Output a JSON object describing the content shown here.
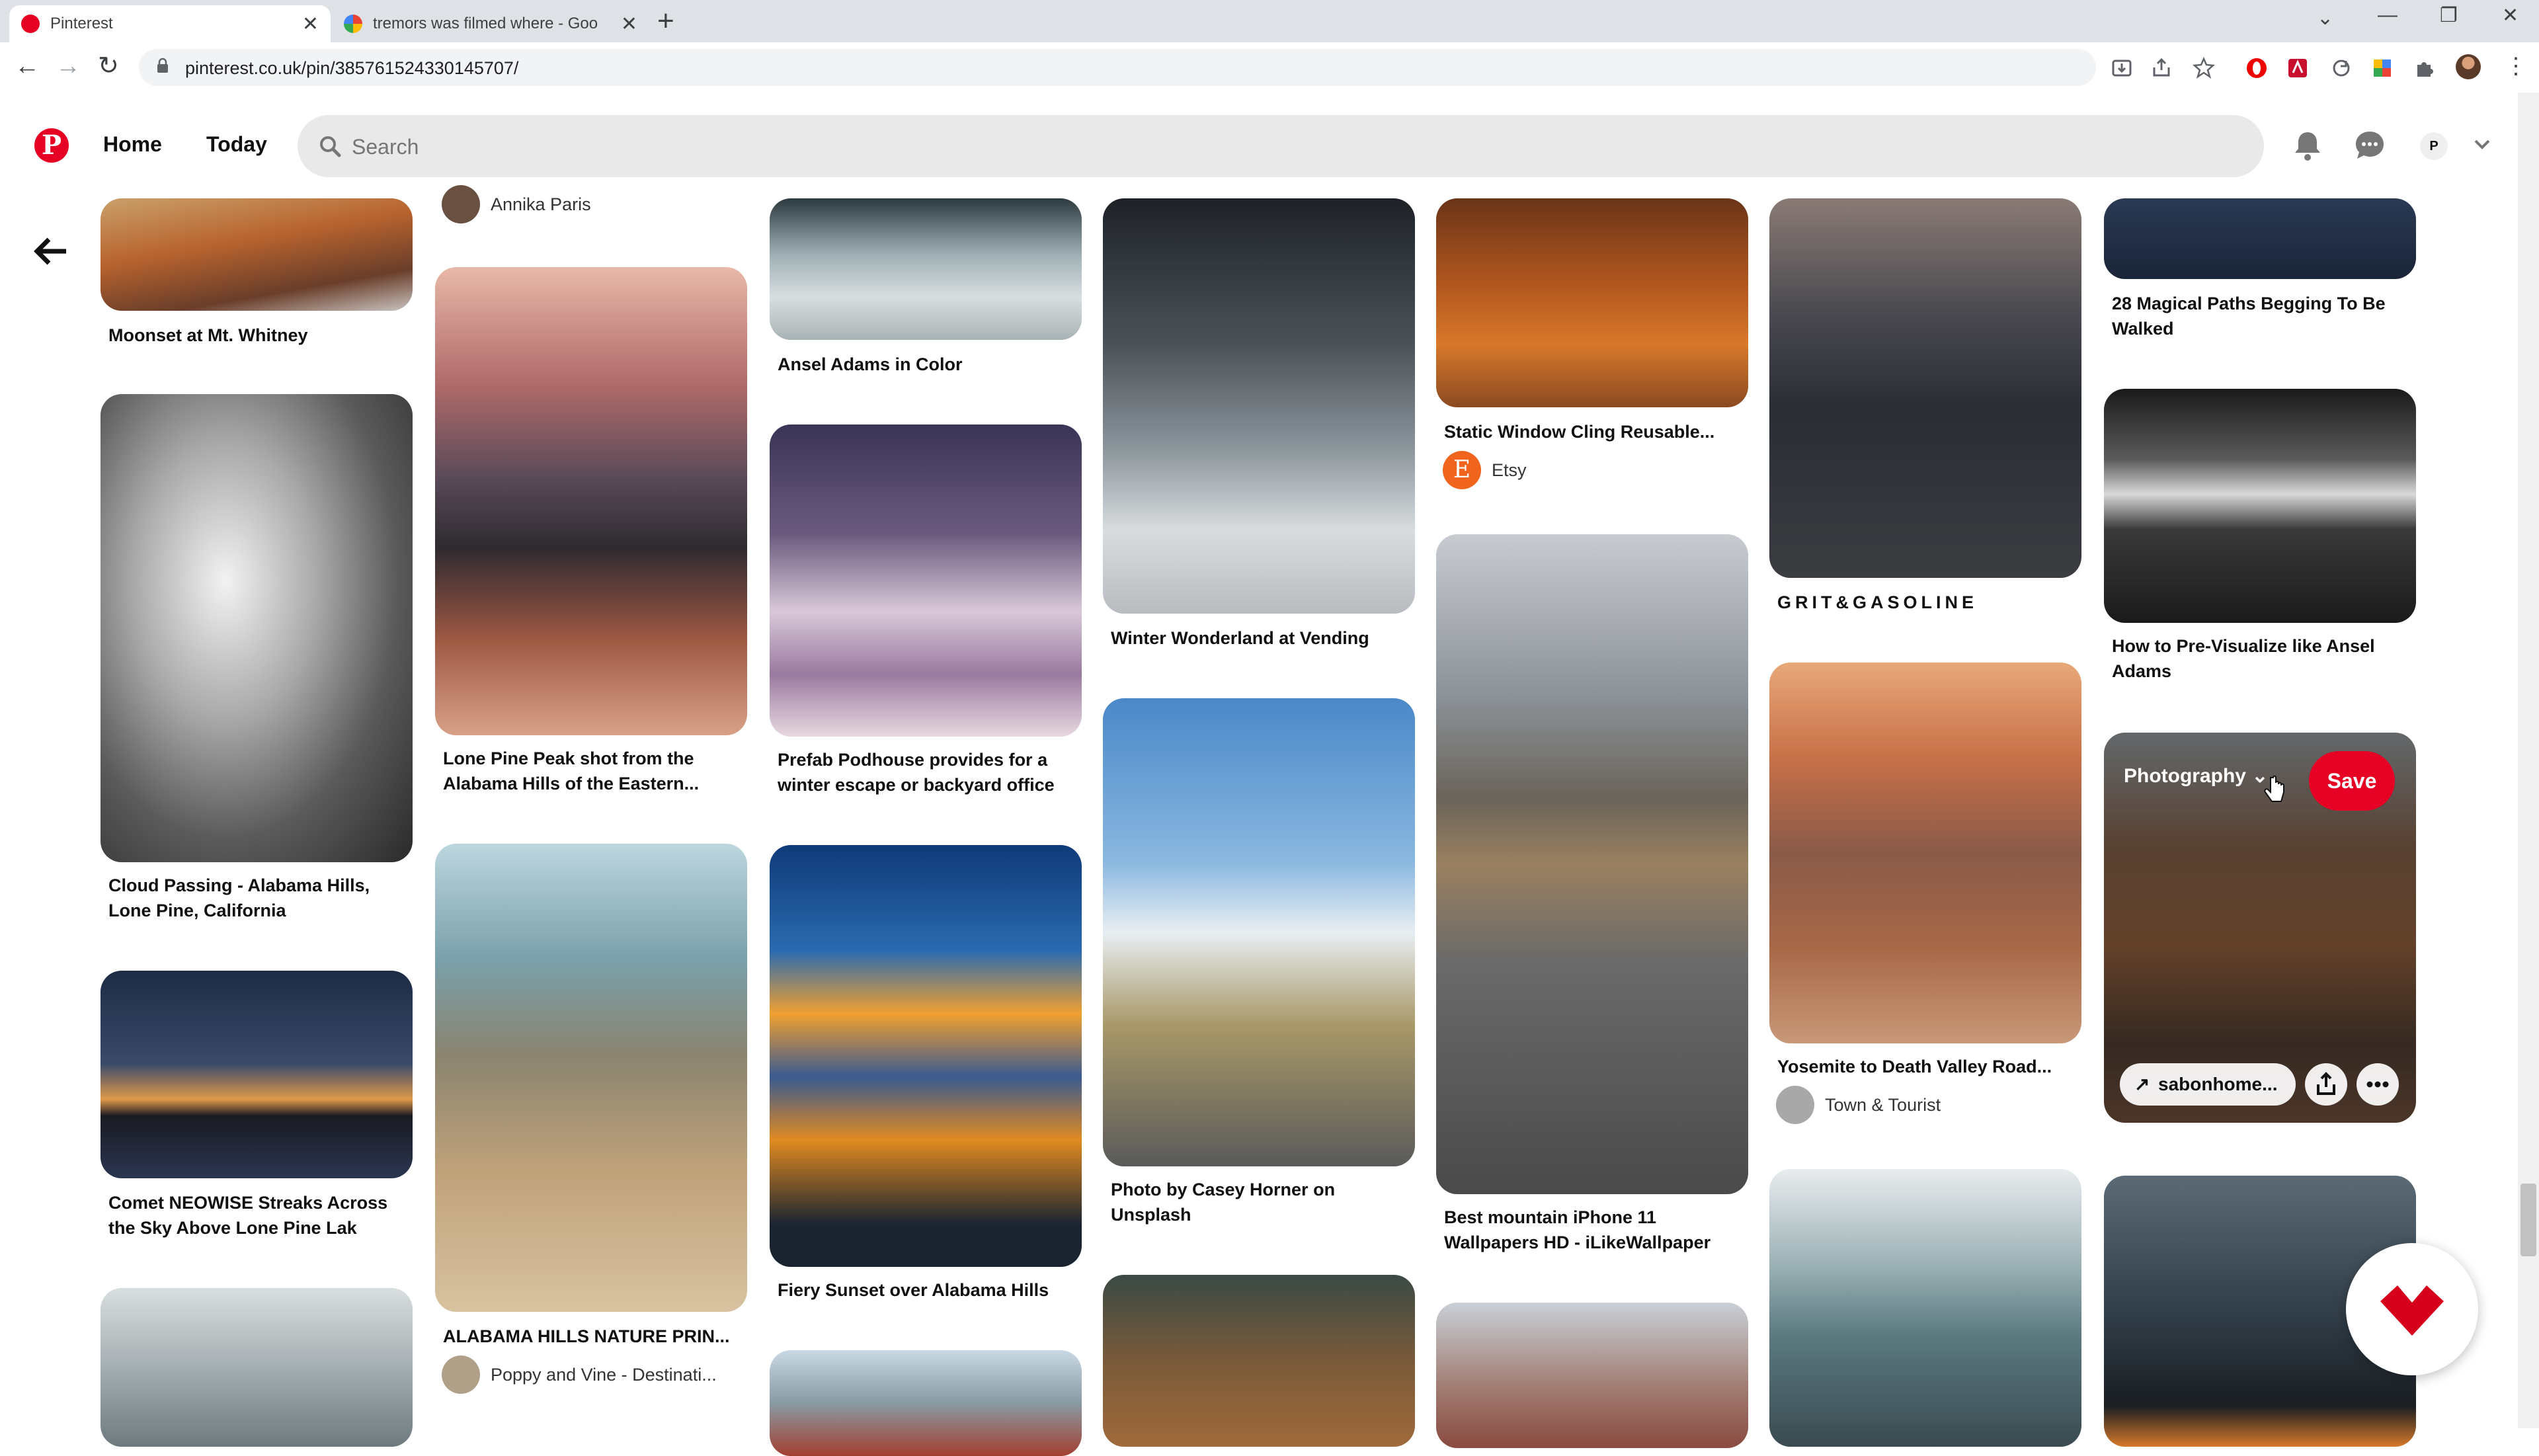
{
  "browser": {
    "tabs": [
      {
        "title": "Pinterest",
        "active": true
      },
      {
        "title": "tremors was filmed where - Goo",
        "active": false
      }
    ],
    "new_tab": "+",
    "url": "pinterest.co.uk/pin/385761524330145707/"
  },
  "header": {
    "logo": "P",
    "nav": [
      "Home",
      "Today"
    ],
    "search_placeholder": "Search",
    "avatar_initial": "P"
  },
  "colors": {
    "brand_red": "#e60023",
    "search_bg": "#e9e9e9",
    "tabbar_bg": "#dee1e6"
  },
  "pins": {
    "moonset": "Moonset at Mt. Whitney",
    "annika": "Annika Paris",
    "ansel_color": "Ansel Adams in Color",
    "static_window": "Static Window Cling Reusable...",
    "etsy": "Etsy",
    "etsy_letter": "E",
    "grit": "GRIT&GASOLINE",
    "magical_paths": "28 Magical Paths Begging To Be Walked",
    "cloud_passing": "Cloud Passing - Alabama Hills, Lone Pine, California",
    "lone_pine": "Lone Pine Peak shot from the Alabama Hills of the Eastern...",
    "prefab": "Prefab Podhouse provides for a winter escape or backyard office",
    "winter_wonderland": "Winter Wonderland at Vending",
    "pre_visualize": "How to Pre-Visualize like Ansel Adams",
    "comet": "Comet NEOWISE Streaks Across the Sky Above Lone Pine Lak",
    "alabama_nature": "ALABAMA HILLS NATURE PRIN...",
    "poppy": "Poppy and Vine - Destinati...",
    "fiery_sunset": "Fiery Sunset over Alabama Hills",
    "casey_horner": "Photo by Casey Horner on Unsplash",
    "best_mountain": "Best mountain iPhone 11 Wallpapers HD - iLikeWallpaper",
    "yosemite": "Yosemite to Death Valley Road...",
    "town_tourist": "Town & Tourist"
  },
  "hover_pin": {
    "board": "Photography",
    "save": "Save",
    "link": "sabonhome..."
  }
}
